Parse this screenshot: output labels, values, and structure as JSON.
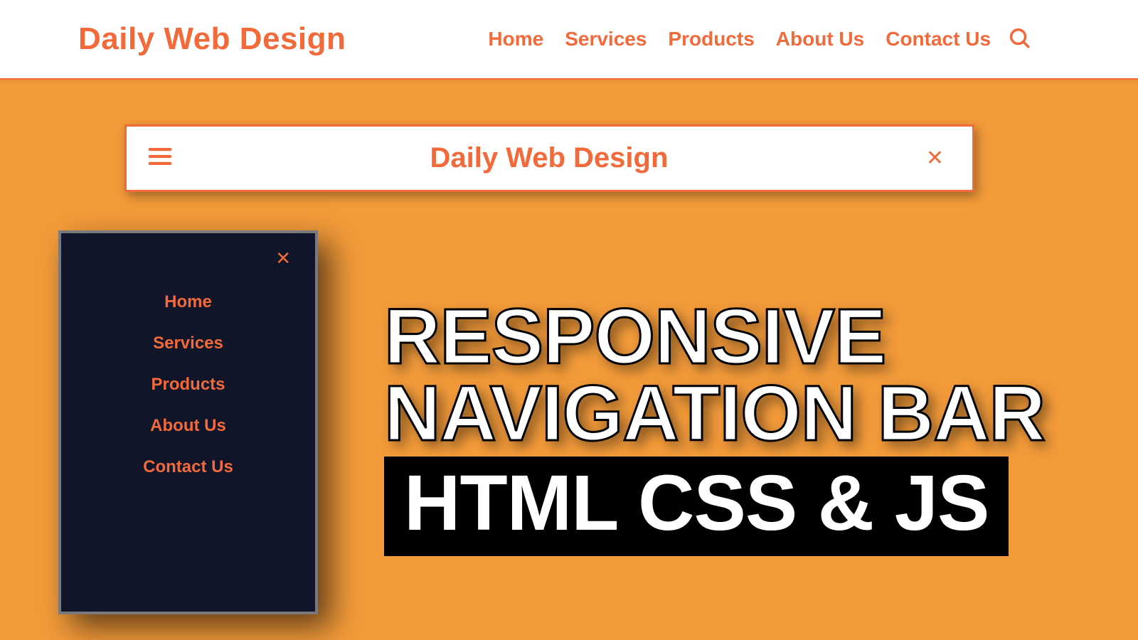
{
  "brand": "Daily Web Design",
  "topnav": {
    "items": [
      "Home",
      "Services",
      "Products",
      "About Us",
      "Contact Us"
    ]
  },
  "mobilebar": {
    "logo": "Daily Web Design",
    "close_glyph": "✕"
  },
  "sidemenu": {
    "close_glyph": "✕",
    "items": [
      "Home",
      "Services",
      "Products",
      "About Us",
      "Contact Us"
    ]
  },
  "headline": {
    "line1": "RESPONSIVE",
    "line2": "NAVIGATION BAR",
    "line3": "HTML CSS & JS"
  }
}
